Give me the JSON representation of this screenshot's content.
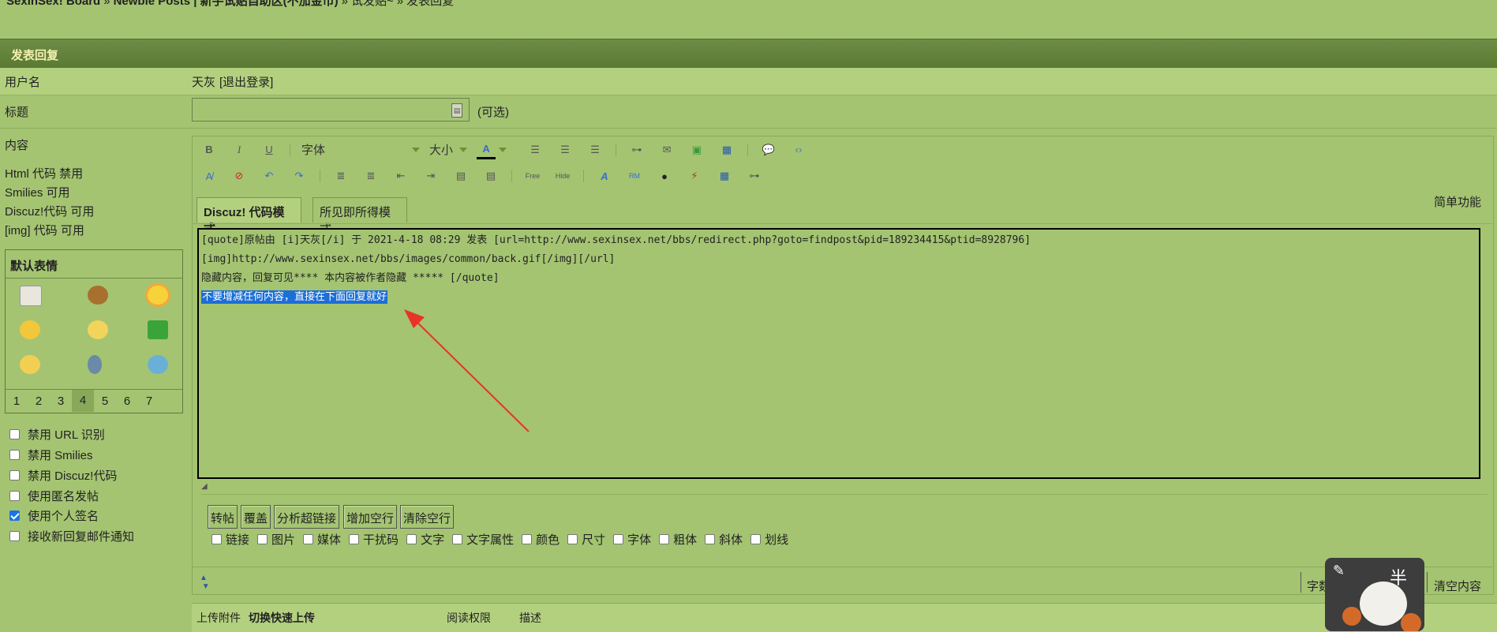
{
  "breadcrumb": {
    "site": "SexInSex! Board",
    "sep": "»",
    "forum": "Newbie Posts | 新手试贴自助区(不加金币)",
    "thread": "试发贴~",
    "current": "发表回复"
  },
  "panel_title": "发表回复",
  "username": {
    "label": "用户名",
    "value": "天灰",
    "logout": "[退出登录]"
  },
  "subject": {
    "label": "标题",
    "value": "",
    "optional": "(可选)"
  },
  "content": {
    "label": "内容",
    "rules": [
      "Html 代码 禁用",
      "Smilies 可用",
      "Discuz!代码 可用",
      "[img] 代码 可用"
    ]
  },
  "toolbar": {
    "font_label": "字体",
    "size_label": "大小",
    "simple_mode": "简单功能",
    "row1_icons": [
      "bold-icon",
      "italic-icon",
      "underline-icon"
    ],
    "row1_icons_b": [
      "align-left-icon",
      "align-center-icon",
      "align-right-icon",
      "link-icon",
      "email-icon",
      "image-icon",
      "media-icon",
      "quote-icon",
      "code-icon"
    ],
    "row2_icons": [
      "remove-format-icon",
      "unlink-icon",
      "undo-icon",
      "redo-icon",
      "ordered-list-icon",
      "unordered-list-icon",
      "outdent-icon",
      "indent-icon",
      "float-left-icon",
      "float-right-icon",
      "free-icon",
      "hide-icon",
      "font-style-icon",
      "rm-icon",
      "qq-icon",
      "flash-icon",
      "video-icon",
      "table-icon"
    ]
  },
  "modes": {
    "code": "Discuz! 代码模式",
    "wysiwyg": "所见即所得模式"
  },
  "editor_lines": [
    "[quote]原帖由 [i]天灰[/i] 于 2021-4-18 08:29 发表 [url=http://www.sexinsex.net/bbs/redirect.php?goto=findpost&pid=189234415&ptid=8928796]",
    "[img]http://www.sexinsex.net/bbs/images/common/back.gif[/img][/url]",
    "隐藏内容，回复可见**** 本内容被作者隐藏 ***** [/quote]"
  ],
  "editor_selected": "不要增减任何内容，直接在下面回复就好",
  "smilies": {
    "title": "默认表情",
    "icons": [
      "envelope-icon",
      "poop-icon",
      "sun-icon",
      "cool-face-icon",
      "confused-face-icon",
      "gift-icon",
      "thinking-face-icon",
      "phone-icon",
      "cloud-icon"
    ],
    "pages": [
      "1",
      "2",
      "3",
      "4",
      "5",
      "6",
      "7"
    ],
    "current_page": "4"
  },
  "options": [
    {
      "label": "禁用 URL 识别",
      "checked": false
    },
    {
      "label": "禁用 Smilies",
      "checked": false
    },
    {
      "label": "禁用 Discuz!代码",
      "checked": false
    },
    {
      "label": "使用匿名发帖",
      "checked": false
    },
    {
      "label": "使用个人签名",
      "checked": true
    },
    {
      "label": "接收新回复邮件通知",
      "checked": false
    }
  ],
  "action_buttons": [
    "转帖",
    "覆盖",
    "分析超链接",
    "增加空行",
    "清除空行"
  ],
  "filters": [
    "链接",
    "图片",
    "媒体",
    "干扰码",
    "文字",
    "文字属性",
    "颜色",
    "尺寸",
    "字体",
    "粗体",
    "斜体",
    "划线"
  ],
  "footer": {
    "word_count": "字数",
    "clear": "清空内容"
  },
  "attachments": {
    "upload": "上传附件",
    "switch": "切换快速上传",
    "permission": "阅读权限",
    "desc": "描述"
  },
  "sticker_text": "半",
  "colors": {
    "bg": "#a4c472",
    "bar": "#5a7a33",
    "highlight": "#1c6fd6",
    "arrow": "#e8332a"
  }
}
